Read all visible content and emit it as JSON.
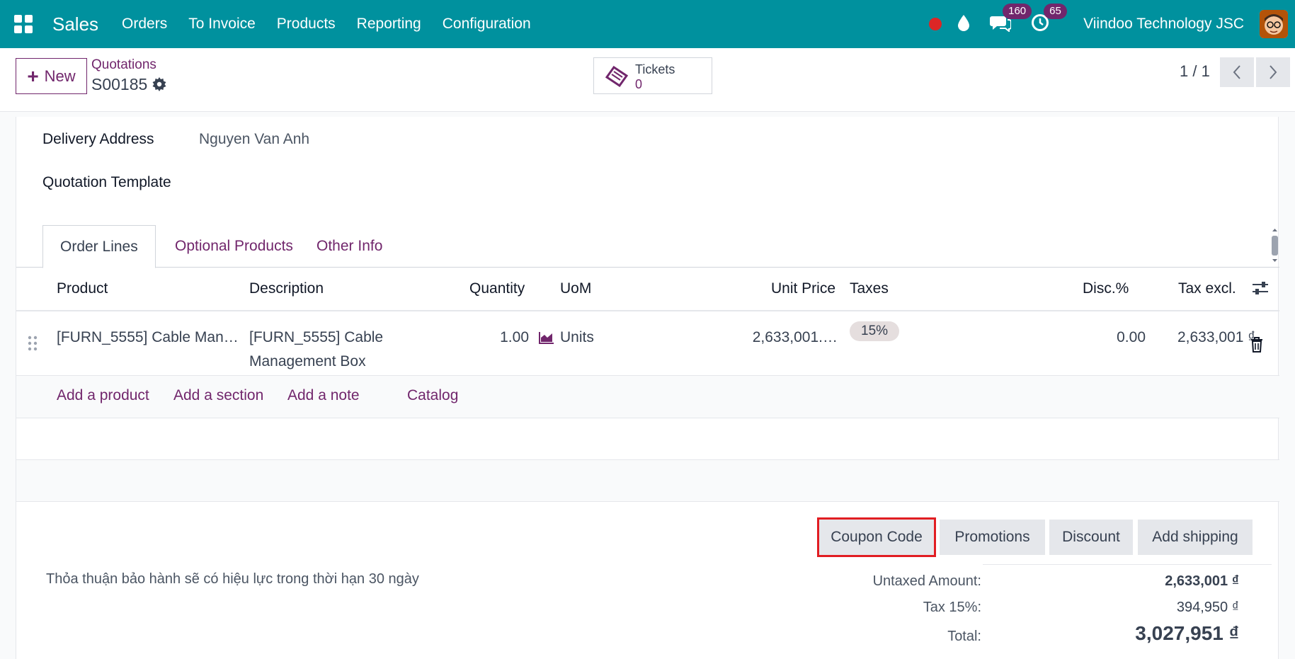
{
  "navbar": {
    "app_name": "Sales",
    "menu": [
      "Orders",
      "To Invoice",
      "Products",
      "Reporting",
      "Configuration"
    ],
    "messages_count": "160",
    "activities_count": "65",
    "company": "Viindoo Technology JSC",
    "colors": {
      "bar": "#00919e",
      "badge": "#71266c",
      "record": "#dc2626"
    }
  },
  "control": {
    "new_label": "New",
    "breadcrumb_parent": "Quotations",
    "record_name": "S00185",
    "tickets_label": "Tickets",
    "tickets_value": "0",
    "pager": "1 / 1"
  },
  "form": {
    "delivery_address_label": "Delivery Address",
    "delivery_address_value": "Nguyen Van Anh",
    "quotation_template_label": "Quotation Template"
  },
  "tabs": [
    "Order Lines",
    "Optional Products",
    "Other Info"
  ],
  "table": {
    "headers": [
      "Product",
      "Description",
      "Quantity",
      "UoM",
      "Unit Price",
      "Taxes",
      "Disc.%",
      "Tax excl."
    ],
    "rows": [
      {
        "product": "[FURN_5555] Cable Man…",
        "description_1": "[FURN_5555] Cable",
        "description_2": "Management Box",
        "quantity": "1.00",
        "uom": "Units",
        "unit_price": "2,633,001.…",
        "taxes": "15%",
        "discount": "0.00",
        "subtotal": "2,633,001 ₫"
      }
    ],
    "add_links": [
      "Add a product",
      "Add a section",
      "Add a note",
      "Catalog"
    ]
  },
  "actions": [
    "Coupon Code",
    "Promotions",
    "Discount",
    "Add shipping"
  ],
  "note": "Thỏa thuận bảo hành sẽ có hiệu lực trong thời hạn 30 ngày",
  "totals": {
    "untaxed_label": "Untaxed Amount:",
    "untaxed_value": "2,633,001 ₫",
    "tax_label": "Tax 15%:",
    "tax_value": "394,950 ₫",
    "total_label": "Total:",
    "total_value": "3,027,951 ₫"
  }
}
